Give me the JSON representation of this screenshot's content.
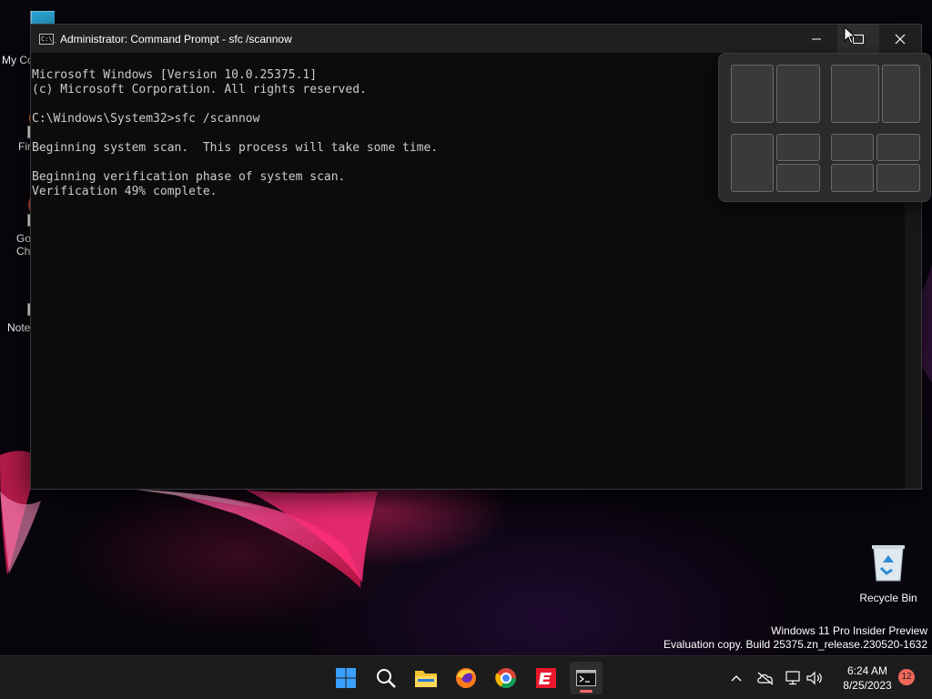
{
  "desktop": {
    "icons": [
      {
        "label": "My Co",
        "icon": "computer-icon"
      },
      {
        "label": "Fir",
        "icon": "firefox-icon"
      },
      {
        "label": "Go\nChi",
        "icon": "chrome-icon"
      },
      {
        "label": "Note",
        "icon": "notepad-icon"
      }
    ],
    "recycle_bin": {
      "label": "Recycle Bin",
      "icon": "recycle-bin-icon"
    },
    "watermark": {
      "line1": "Windows 11 Pro Insider Preview",
      "line2": "Evaluation copy. Build 25375.zn_release.230520-1632"
    }
  },
  "window": {
    "title": "Administrator: Command Prompt - sfc  /scannow",
    "icon": "cmd-icon",
    "console_lines": [
      "Microsoft Windows [Version 10.0.25375.1]",
      "(c) Microsoft Corporation. All rights reserved.",
      "",
      "C:\\Windows\\System32>sfc /scannow",
      "",
      "Beginning system scan.  This process will take some time.",
      "",
      "Beginning verification phase of system scan.",
      "Verification 49% complete."
    ],
    "controls": [
      "minimize-icon",
      "maximize-icon",
      "close-icon"
    ]
  },
  "snap_layouts": {
    "visible": true,
    "layouts": [
      "two-halves",
      "two-thirds-left",
      "left-half-right-quarters",
      "four-quarters"
    ]
  },
  "taskbar": {
    "apps": [
      "start-icon",
      "search-icon",
      "file-explorer-icon",
      "firefox-icon",
      "chrome-icon",
      "espn-icon",
      "terminal-icon"
    ],
    "active_app": "terminal-icon",
    "tray": [
      "chevron-up-icon",
      "onedrive-icon",
      "network-icon",
      "volume-icon"
    ],
    "clock": {
      "time": "6:24 AM",
      "date": "8/25/2023"
    },
    "notifications": "12"
  },
  "colors": {
    "console_bg": "#0c0c0c",
    "console_text": "#cccccc",
    "titlebar": "#202020",
    "taskbar": "#1c1c1c",
    "accent": "#0078d4"
  }
}
